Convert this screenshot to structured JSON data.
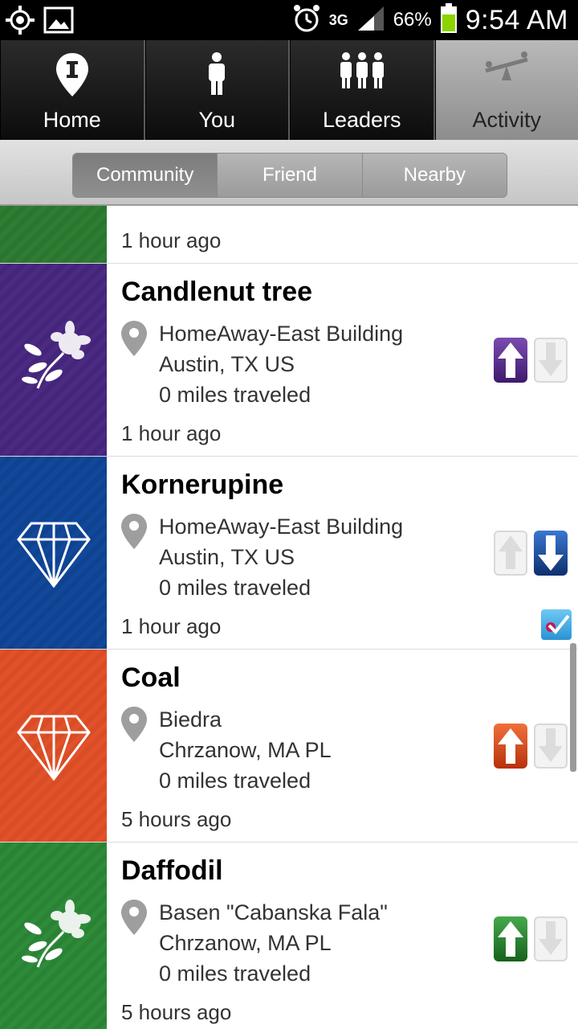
{
  "status_bar": {
    "network": "3G",
    "battery": "66%",
    "time": "9:54 AM"
  },
  "tabs": [
    {
      "label": "Home",
      "icon": "pin-i-icon"
    },
    {
      "label": "You",
      "icon": "person-icon"
    },
    {
      "label": "Leaders",
      "icon": "group-icon"
    },
    {
      "label": "Activity",
      "icon": "seesaw-icon",
      "active": true
    }
  ],
  "filters": [
    {
      "label": "Community",
      "active": true
    },
    {
      "label": "Friend"
    },
    {
      "label": "Nearby"
    }
  ],
  "partial_item": {
    "time": "1 hour ago",
    "color": "#2e7d32"
  },
  "items": [
    {
      "title": "Candlenut tree",
      "place": "HomeAway-East Building",
      "region": "Austin, TX  US",
      "distance": "0 miles traveled",
      "time": "1 hour ago",
      "color": "#4b2a82",
      "icon": "flower-icon",
      "vote": "up"
    },
    {
      "title": "Kornerupine",
      "place": "HomeAway-East Building",
      "region": "Austin, TX  US",
      "distance": "0 miles traveled",
      "time": "1 hour ago",
      "color": "#12489a",
      "icon": "diamond-icon",
      "vote": "down",
      "foursquare_checkin": true
    },
    {
      "title": "Coal",
      "place": "Biedra",
      "region": "Chrzanow, MA  PL",
      "distance": "0 miles traveled",
      "time": "5 hours ago",
      "color": "#e2522a",
      "icon": "diamond-icon",
      "vote": "up"
    },
    {
      "title": "Daffodil",
      "place": "Basen \"Cabanska Fala\"",
      "region": "Chrzanow, MA  PL",
      "distance": "0 miles traveled",
      "time": "5 hours ago",
      "color": "#2e8b3a",
      "icon": "flower-icon",
      "vote": "up"
    }
  ],
  "colors": {
    "up_purple": "#5a2c8c",
    "down_blue": "#1b4c9a",
    "up_orange": "#e34a1c",
    "up_green": "#2a7d2f"
  }
}
